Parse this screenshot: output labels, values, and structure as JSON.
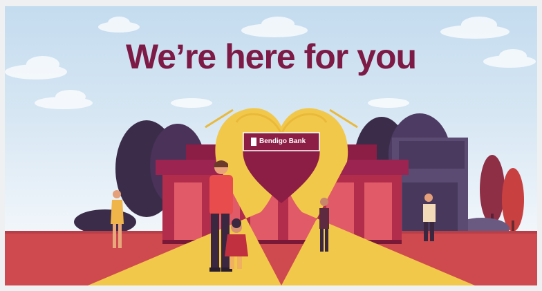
{
  "banner": {
    "headline": "We’re here for you",
    "bank_sign": "Bendigo Bank",
    "colors": {
      "headline": "#7d1a45",
      "sky": "#cfe2f1",
      "ground": "#cf4a4f",
      "building": "#8c1d45",
      "hands": "#f2c84b",
      "trees_dark": "#3b2d4a"
    }
  }
}
